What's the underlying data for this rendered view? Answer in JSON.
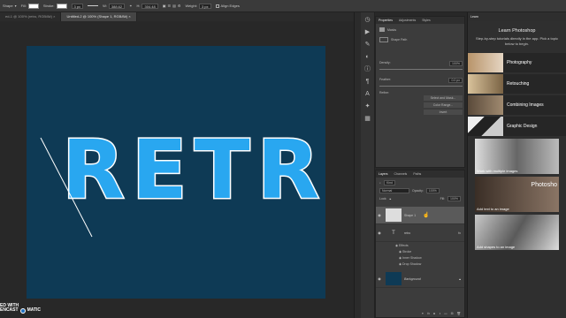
{
  "options_bar": {
    "mode_label": "Shape",
    "fill_label": "Fill:",
    "stroke_label": "Stroke:",
    "stroke_width": "3 px",
    "width_label": "W:",
    "width_value": "388.62",
    "height_label": "H:",
    "height_value": "304.48",
    "weight_label": "Weight:",
    "weight_value": "3 px",
    "align_edges_label": "Align Edges"
  },
  "doc_tabs": [
    {
      "label": "ed-1 @ 100% (retro, RGB/8#)"
    },
    {
      "label": "Untitled-2 @ 100% (Shape 1, RGB/8#)"
    }
  ],
  "canvas_text": "RETRO",
  "properties_panel": {
    "tabs": [
      "Properties",
      "Adjustments",
      "Styles"
    ],
    "masks_label": "Masks",
    "shape_path_label": "Shape Path",
    "density_label": "Density:",
    "density_value": "100%",
    "feather_label": "Feather:",
    "feather_value": "0.0 px",
    "refine_label": "Refine:",
    "select_mask_label": "Select and Mask...",
    "color_range_label": "Color Range...",
    "invert_label": "Invert"
  },
  "layers_panel": {
    "tabs": [
      "Layers",
      "Channels",
      "Paths"
    ],
    "kind_label": "Kind",
    "blend_mode": "Normal",
    "opacity_label": "Opacity:",
    "opacity_value": "100%",
    "lock_label": "Lock:",
    "fill_label": "Fill:",
    "fill_value": "100%",
    "layers": [
      {
        "name": "Shape 1"
      },
      {
        "name": "retro"
      },
      {
        "name": "Background"
      }
    ],
    "effects_label": "Effects",
    "effects": [
      "Stroke",
      "Inner Shadow",
      "Drop Shadow"
    ]
  },
  "learn_panel": {
    "tab_label": "Learn",
    "title": "Learn Photoshop",
    "subtitle": "Step-by-step tutorials directly in the app. Pick a topic below to begin.",
    "topics": [
      {
        "label": "Photography"
      },
      {
        "label": "Retouching"
      },
      {
        "label": "Combining Images"
      },
      {
        "label": "Graphic Design"
      }
    ],
    "cards": [
      {
        "label": "Work with multiple images"
      },
      {
        "label": "Add text to an image",
        "overlay": "Photosho"
      },
      {
        "label": "Add shapes to an image"
      }
    ]
  },
  "watermark": {
    "left_text": "ED WITH",
    "brand_left": "ENCAST",
    "brand_right": "MATIC"
  },
  "colors": {
    "canvas_bg": "#0e3a55",
    "letter_fill": "#29a7f0",
    "letter_edge": "#ffffff",
    "panel_bg": "#3c3c3c"
  }
}
